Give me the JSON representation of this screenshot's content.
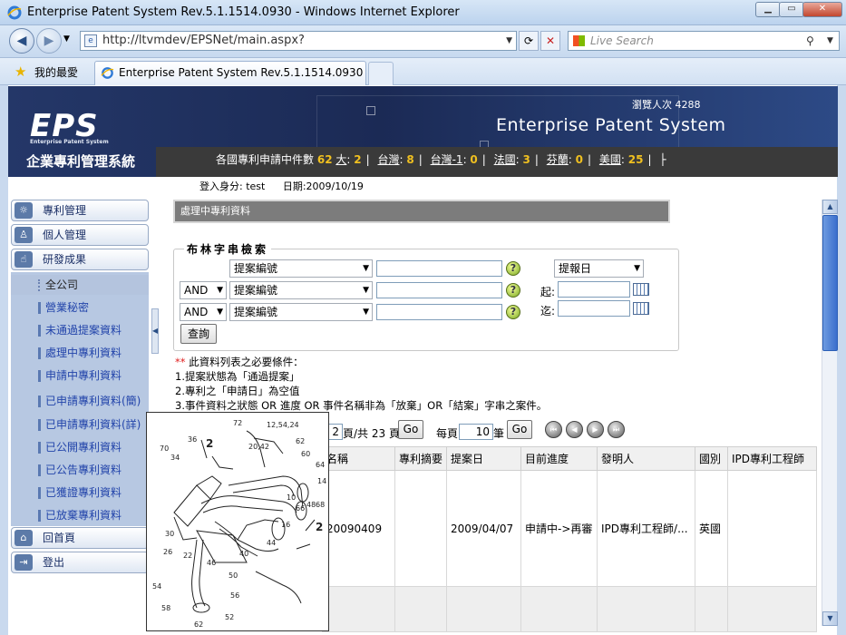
{
  "browser": {
    "window_title": "Enterprise Patent System Rev.5.1.1514.0930 - Windows Internet Explorer",
    "url": "http://ltvmdev/EPSNet/main.aspx?",
    "search_placeholder": "Live Search",
    "favorites_label": "我的最愛",
    "tab_title": "Enterprise Patent System Rev.5.1.1514.0930"
  },
  "header": {
    "logo": "EPS",
    "logo_sub": "Enterprise Patent System",
    "app_name": "企業專利管理系統",
    "visits_label": "瀏覽人次",
    "visits_count": "4288",
    "system_name": "Enterprise Patent System",
    "stats_label": "各國專利申請中件數",
    "stats_total": "62",
    "stats": [
      {
        "country": "大",
        "count": "2"
      },
      {
        "country": "台灣",
        "count": "8"
      },
      {
        "country": "台灣-1",
        "count": "0"
      },
      {
        "country": "法國",
        "count": "3"
      },
      {
        "country": "芬蘭",
        "count": "0"
      },
      {
        "country": "美國",
        "count": "25"
      }
    ],
    "stats_tail": "├"
  },
  "sidebar": {
    "menu": [
      {
        "label": "專利管理",
        "icon": "lightbulb-icon"
      },
      {
        "label": "個人管理",
        "icon": "person-icon"
      },
      {
        "label": "研發成果",
        "icon": "thumbs-up-icon"
      }
    ],
    "submenu": [
      "全公司",
      "營業秘密",
      "未通過提案資料",
      "處理中專利資料",
      "申請中專利資料",
      "已申請專利資料(簡)",
      "已申請專利資料(詳)",
      "已公開專利資料",
      "已公告專利資料",
      "已獲證專利資料",
      "已放棄專利資料"
    ],
    "home": "回首頁",
    "logout": "登出"
  },
  "main": {
    "login_label": "登入身分: test",
    "date_label": "日期:2009/10/19",
    "section_title": "處理中專利資料",
    "search": {
      "legend": "布林字串檢索",
      "field_option": "提案編號",
      "op_option": "AND",
      "date_option": "提報日",
      "from_label": "起:",
      "to_label": "迄:",
      "query_button": "查詢"
    },
    "conditions": {
      "stars": "**",
      "intro": "此資料列表之必要條件：",
      "lines": [
        "1.提案狀態為「通過提案」",
        "2.專利之「申請日」為空值",
        "3.事件資料之狀態 OR 進度 OR 事件名稱非為「放棄」OR「結案」字串之案件。"
      ]
    },
    "pager": {
      "current_page": "2",
      "total_text": "頁/共 23 頁",
      "go": "Go",
      "per_page_label": "每頁",
      "per_page": "10",
      "per_page_unit": "筆"
    },
    "table": {
      "headers": [
        "名稱",
        "專利摘要",
        "提案日",
        "目前進度",
        "發明人",
        "國別",
        "IPD專利工程師"
      ],
      "rows": [
        [
          "20090409",
          "",
          "2009/04/07",
          "申請中->再審",
          "IPD專利工程師/...",
          "英國",
          ""
        ]
      ]
    }
  },
  "drawing_labels": [
    "72",
    "12,54,24",
    "36",
    "2",
    "20,42",
    "70",
    "34",
    "62",
    "60",
    "64",
    "14",
    "10",
    "48",
    "66",
    "68",
    "16",
    "2",
    "30",
    "26",
    "44",
    "40",
    "22",
    "46",
    "50",
    "56",
    "52",
    "54",
    "58",
    "62"
  ]
}
